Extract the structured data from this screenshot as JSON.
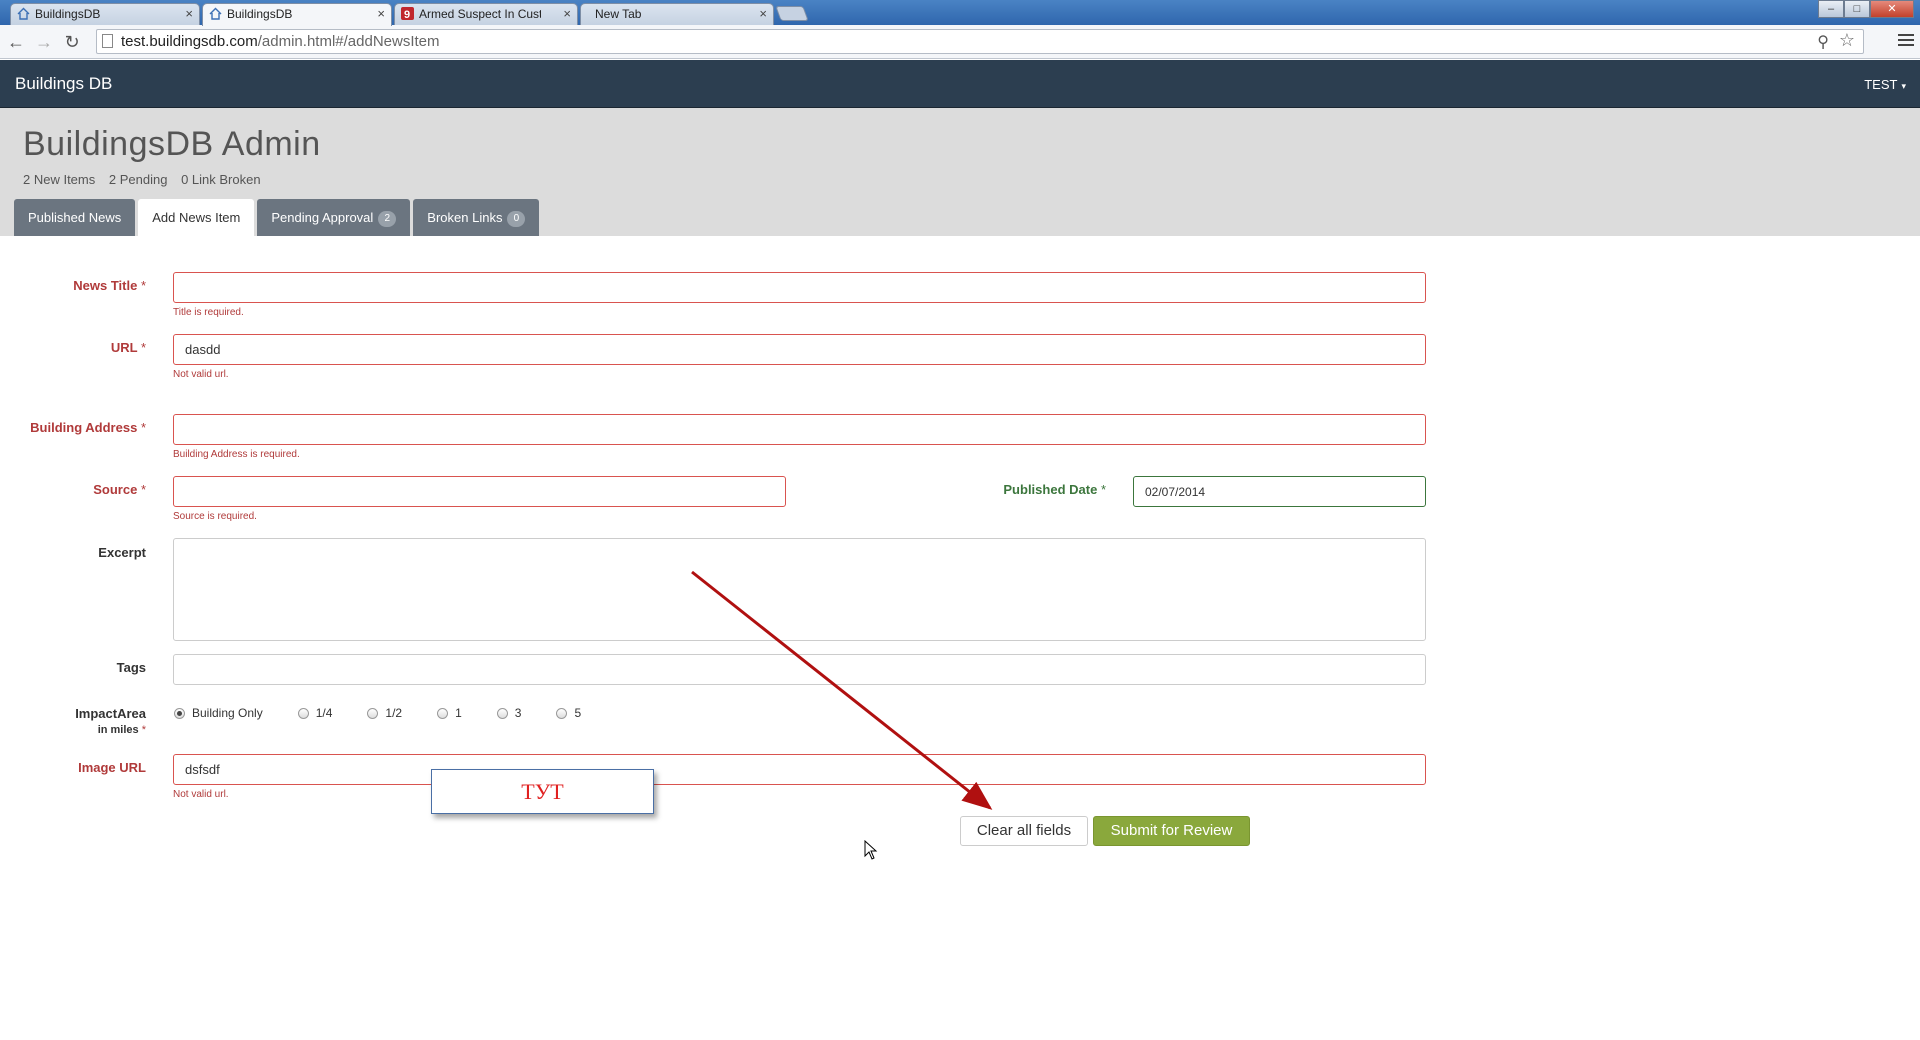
{
  "browser": {
    "tabs": [
      {
        "title": "BuildingsDB",
        "close": "×"
      },
      {
        "title": "BuildingsDB",
        "close": "×"
      },
      {
        "title": "Armed Suspect In Custody",
        "close": "×"
      },
      {
        "title": "New Tab",
        "close": "×"
      }
    ],
    "url_host": "test.buildingsdb.com",
    "url_path": "/admin.html#/addNewsItem",
    "window_controls": {
      "minimize": "–",
      "maximize": "□",
      "close": "✕"
    }
  },
  "navbar": {
    "brand": "Buildings DB",
    "user": "TEST",
    "caret": "▾"
  },
  "header": {
    "title": "BuildingsDB Admin",
    "stats": [
      "2 New Items",
      "2 Pending",
      "0 Link Broken"
    ],
    "tabs": [
      {
        "label": "Published News"
      },
      {
        "label": "Add News Item"
      },
      {
        "label": "Pending Approval",
        "badge": "2"
      },
      {
        "label": "Broken Links",
        "badge": "0"
      }
    ]
  },
  "form": {
    "news_title": {
      "label": "News Title",
      "req": "*",
      "value": "",
      "error": "Title is required."
    },
    "url": {
      "label": "URL",
      "req": "*",
      "value": "dasdd",
      "error": "Not valid url."
    },
    "building_address": {
      "label": "Building Address",
      "req": "*",
      "value": "",
      "error": "Building Address is required."
    },
    "source": {
      "label": "Source",
      "req": "*",
      "value": "",
      "error": "Source is required."
    },
    "published_date": {
      "label": "Published Date",
      "req": "*",
      "value": "02/07/2014"
    },
    "excerpt": {
      "label": "Excerpt",
      "value": ""
    },
    "tags": {
      "label": "Tags",
      "value": ""
    },
    "impact_area": {
      "label": "ImpactArea",
      "sublabel": "in miles",
      "req": "*",
      "options": [
        "Building Only",
        "1/4",
        "1/2",
        "1",
        "3",
        "5"
      ],
      "selected": "Building Only"
    },
    "image_url": {
      "label": "Image URL",
      "value": "dsfsdf",
      "error": "Not valid url."
    },
    "clear_label": "Clear all fields",
    "submit_label": "Submit for Review"
  },
  "annotation": {
    "text": "ТУТ",
    "color": "#e02020"
  }
}
